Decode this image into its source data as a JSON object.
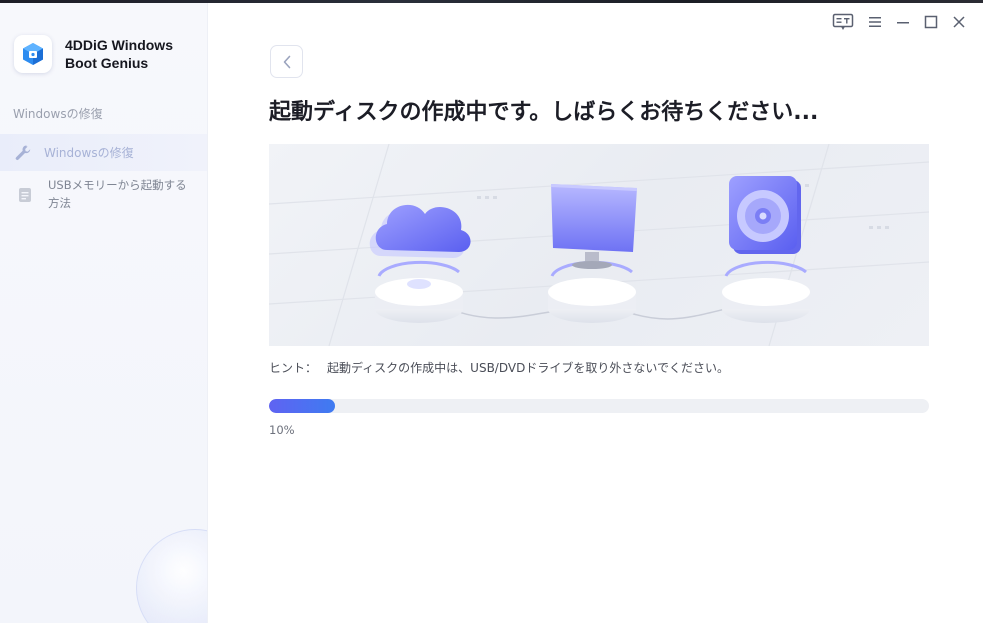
{
  "app": {
    "name": "4DDiG Windows\nBoot Genius"
  },
  "sidebar": {
    "section_title": "Windowsの修復",
    "items": [
      {
        "label": "Windowsの修復",
        "icon": "wrench-icon",
        "active": true
      },
      {
        "label": "USBメモリーから起動する方法",
        "icon": "document-icon",
        "active": false
      }
    ]
  },
  "main": {
    "title": "起動ディスクの作成中です。しばらくお待ちください...",
    "hint_label": "ヒント：",
    "hint_text": "起動ディスクの作成中は、USB/DVDドライブを取り外さないでください。",
    "progress": {
      "percent": 10,
      "label": "10%"
    }
  },
  "colors": {
    "accent": "#5f63f2",
    "accent_end": "#3f7bf1",
    "sidebar_bg": "#f5f7fc",
    "illustration_purple": "#7b7cf5"
  }
}
